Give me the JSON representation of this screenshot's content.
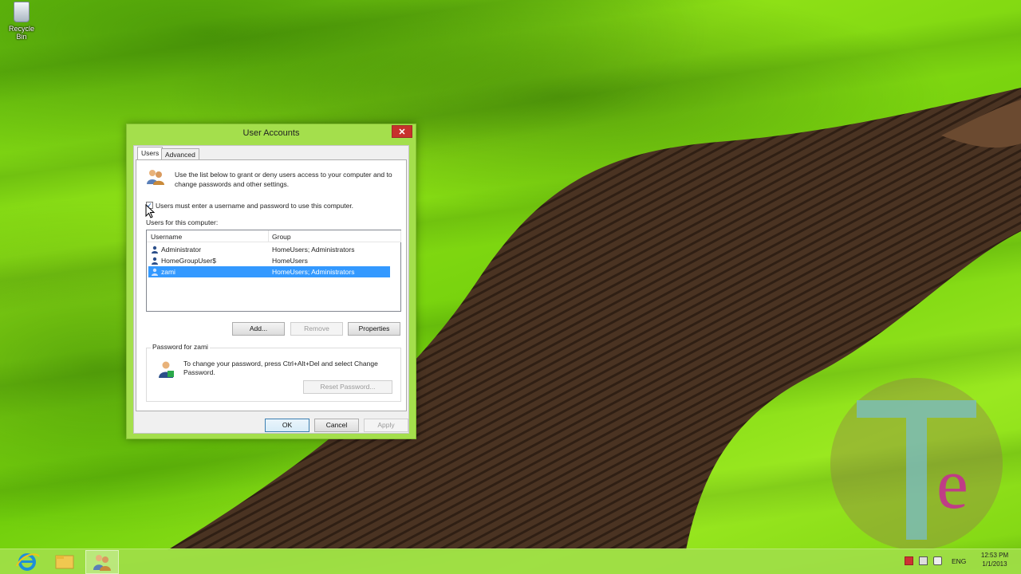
{
  "desktop": {
    "recycle_bin_label": "Recycle Bin"
  },
  "dialog": {
    "title": "User Accounts",
    "close_glyph": "✕",
    "tabs": [
      {
        "label": "Users",
        "active": true
      },
      {
        "label": "Advanced",
        "active": false
      }
    ],
    "intro_text": "Use the list below to grant or deny users access to your computer and to change passwords and other settings.",
    "require_login_checkbox": {
      "label": "Users must enter a username and password to use this computer.",
      "checked": true,
      "check_glyph": "✓"
    },
    "users_for_label": "Users for this computer:",
    "list_headers": {
      "username": "Username",
      "group": "Group"
    },
    "users": [
      {
        "username": "Administrator",
        "group": "HomeUsers; Administrators",
        "selected": false
      },
      {
        "username": "HomeGroupUser$",
        "group": "HomeUsers",
        "selected": false
      },
      {
        "username": "zami",
        "group": "HomeUsers; Administrators",
        "selected": true
      }
    ],
    "buttons": {
      "add": "Add...",
      "remove": "Remove",
      "properties": "Properties",
      "reset_password": "Reset Password...",
      "ok": "OK",
      "cancel": "Cancel",
      "apply": "Apply"
    },
    "password_group": {
      "legend": "Password for zami",
      "text": "To change your password, press Ctrl+Alt+Del and select Change Password."
    }
  },
  "taskbar": {
    "apps": [
      "internet-explorer-icon",
      "file-explorer-icon",
      "user-accounts-icon"
    ],
    "language": "ENG",
    "time": "12:53 PM",
    "date": "1/1/2013"
  },
  "colors": {
    "accent": "#a4df4c",
    "selection": "#3399ff",
    "close": "#c7312d"
  }
}
